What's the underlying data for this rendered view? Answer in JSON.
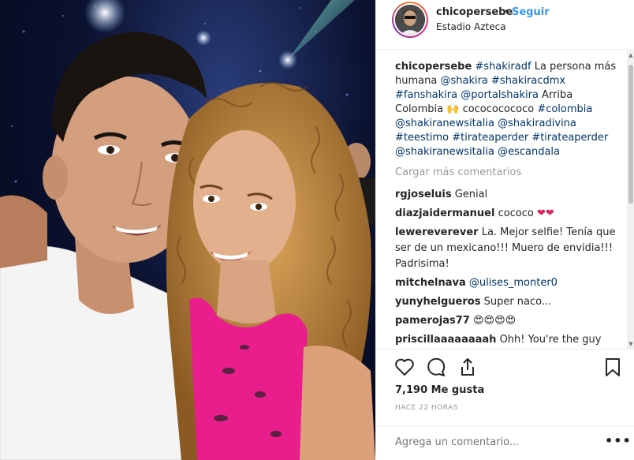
{
  "header": {
    "username": "chicopersebe",
    "dot": "•",
    "follow": "Seguir",
    "location": "Estadio Azteca"
  },
  "caption": {
    "username": "chicopersebe",
    "parts": [
      "#shakiradf",
      "La persona más humana",
      "@shakira",
      "#shakiracdmx",
      "#fanshakira",
      "@portalshakira",
      "Arriba Colombia",
      "🙌",
      "cocococococo",
      "#colombia",
      "@shakiranewsitalia",
      "@shakiradivina",
      "#teestimo",
      "#tirateaperder",
      "#tirateaperder",
      "@shakiranewsitalia",
      "@escandala"
    ]
  },
  "load_more": "Cargar más comentarios",
  "comments": [
    {
      "user": "rgjoseluis",
      "text": "Genial"
    },
    {
      "user": "diazjaidermanuel",
      "text": "cococo"
    },
    {
      "user": "lewereverever",
      "text": "La. Mejor selfie! Tenía que ser de un mexicano!!! Muero de envidia!!! Padrisima!"
    },
    {
      "user": "mitchelnava",
      "mention": "@ulises_monter0"
    },
    {
      "user": "yunyhelgueros",
      "text": "Super naco..."
    },
    {
      "user": "pamerojas77",
      "emoji": "😍😍😍😍"
    },
    {
      "user": "priscillaaaaaaaah",
      "text": "Ohh! You're the guy who"
    }
  ],
  "likes": "7,190 Me gusta",
  "timestamp": "HACE 22 HORAS",
  "add_comment_placeholder": "Agrega un comentario...",
  "more_options": "•••",
  "colors": {
    "link": "#003569",
    "follow": "#3897f0",
    "muted": "#999999",
    "pink": "#e91e8c"
  }
}
